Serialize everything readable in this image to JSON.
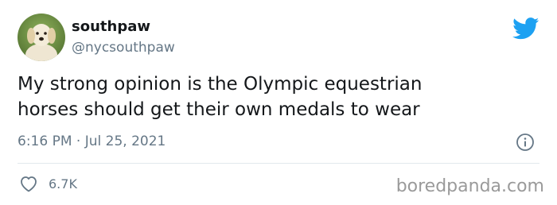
{
  "user": {
    "display_name": "southpaw",
    "username": "@nycsouthpaw",
    "avatar_icon": "puppy-avatar"
  },
  "tweet": {
    "text_line1": "My strong opinion is the Olympic equestrian",
    "text_line2": "horses should get their own medals to wear",
    "timestamp": "6:16 PM · Jul 25, 2021"
  },
  "actions": {
    "like_icon": "heart-icon",
    "like_count": "6.7K",
    "info_icon": "info-icon"
  },
  "brand": {
    "logo_icon": "twitter-bird-icon",
    "accent": "#1da1f2"
  },
  "watermark": "boredpanda.com"
}
